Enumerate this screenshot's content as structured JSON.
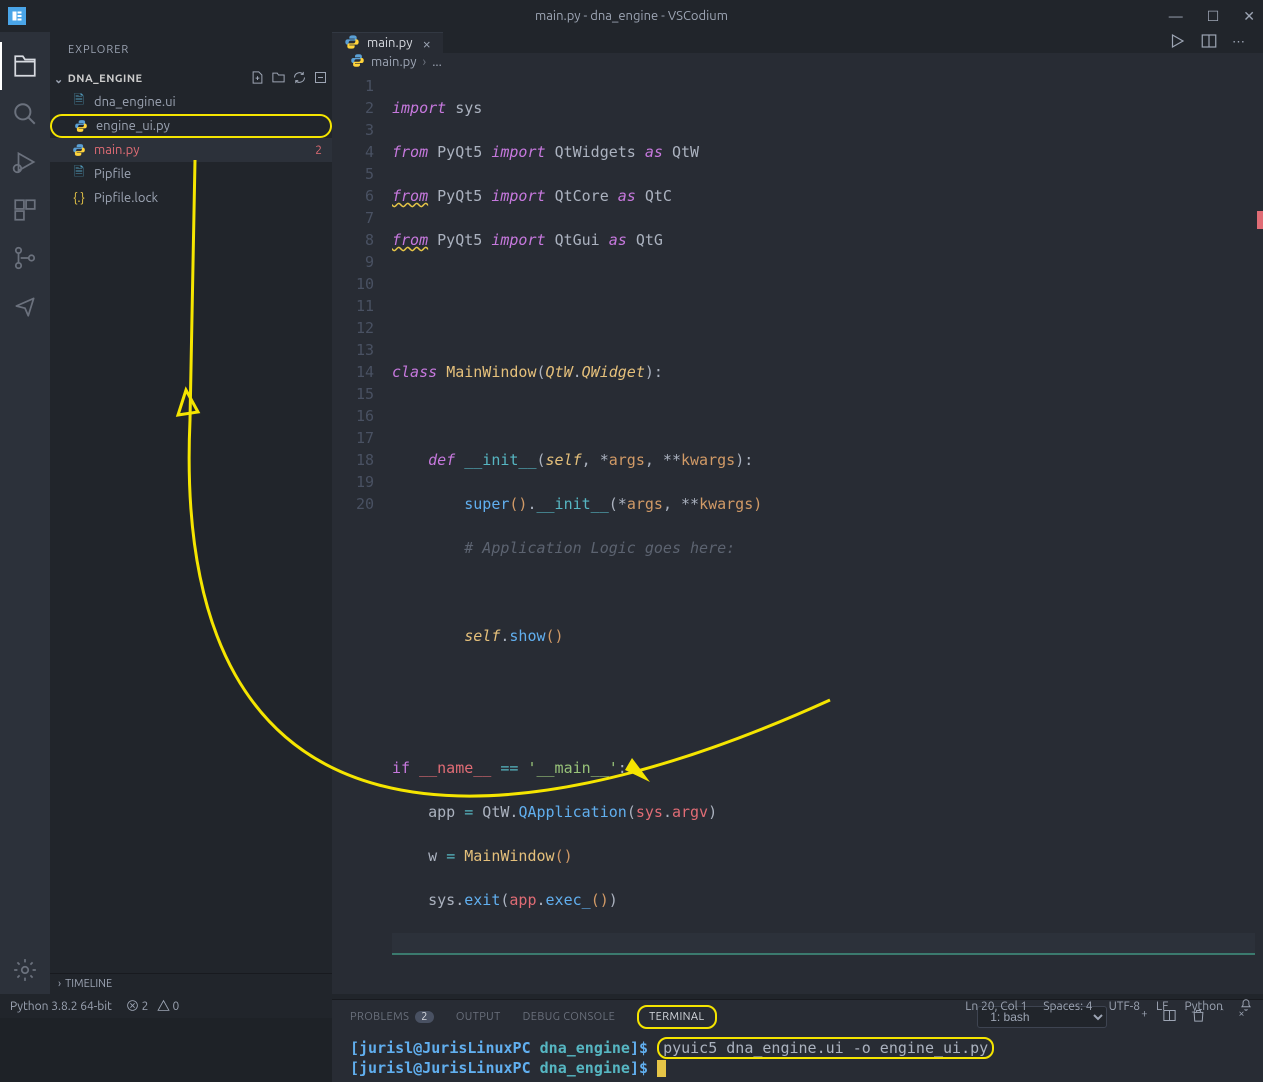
{
  "window": {
    "title": "main.py - dna_engine - VSCodium"
  },
  "sidebar": {
    "title": "EXPLORER",
    "folder": "DNA_ENGINE",
    "files": [
      {
        "name": "dna_engine.ui",
        "icon": "file",
        "iconClass": "icon-blue"
      },
      {
        "name": "engine_ui.py",
        "icon": "python",
        "iconClass": "icon-py",
        "highlighted": true
      },
      {
        "name": "main.py",
        "icon": "python",
        "iconClass": "icon-py",
        "active": true,
        "error_count": "2"
      },
      {
        "name": "Pipfile",
        "icon": "file",
        "iconClass": "icon-blue"
      },
      {
        "name": "Pipfile.lock",
        "icon": "json",
        "iconClass": "icon-json"
      }
    ],
    "timeline": "TIMELINE"
  },
  "tabs": {
    "items": [
      {
        "name": "main.py"
      }
    ]
  },
  "breadcrumb": {
    "file": "main.py",
    "dots": "..."
  },
  "code": {
    "lines": 20
  },
  "panel": {
    "tabs": {
      "problems": "PROBLEMS",
      "problems_badge": "2",
      "output": "OUTPUT",
      "debug": "DEBUG CONSOLE",
      "terminal": "TERMINAL"
    },
    "term_select": "1: bash",
    "prompt_user": "[jurisl@JurisLinuxPC ",
    "prompt_path": "dna_engine",
    "prompt_end": "]$",
    "command": "pyuic5 dna_engine.ui -o engine_ui.py"
  },
  "status": {
    "python": "Python 3.8.2 64-bit",
    "errors": "2",
    "warnings": "0",
    "ln_col": "Ln 20, Col 1",
    "spaces": "Spaces: 4",
    "enc": "UTF-8",
    "eol": "LF",
    "lang": "Python"
  }
}
